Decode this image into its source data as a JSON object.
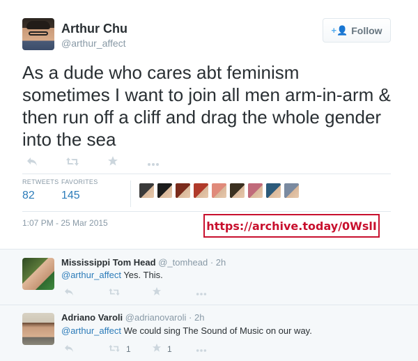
{
  "tweet": {
    "author_name": "Arthur Chu",
    "author_handle": "@arthur_affect",
    "follow_label": "Follow",
    "text": "As a dude who cares abt feminism sometimes I want to join all men arm-in-arm & then run off a cliff and drag the whole gender into the sea",
    "retweets_label": "RETWEETS",
    "retweets_count": "82",
    "favorites_label": "FAVORITES",
    "favorites_count": "145",
    "timestamp": "1:07 PM - 25 Mar 2015"
  },
  "annotation": {
    "archive_link": "https://archive.today/0WslI",
    "color": "#c8102e"
  },
  "icons": {
    "reply": "reply-icon",
    "retweet": "retweet-icon",
    "favorite": "star-icon",
    "more": "more-icon",
    "follow": "person-plus-icon"
  },
  "favoriter_colors": [
    "#3a3a3a",
    "#1c1c1c",
    "#7a2b1c",
    "#b03a2a",
    "#e08a7a",
    "#3b3020",
    "#c06a7a",
    "#2c5a7a",
    "#7a8aa0",
    "#a07a5a"
  ],
  "replies": [
    {
      "name": "Mississippi Tom Head",
      "handle": "@_tomhead",
      "time": "· 2h",
      "mention": "@arthur_affect",
      "text": " Yes. This.",
      "retweet_count": "",
      "favorite_count": ""
    },
    {
      "name": "Adriano Varoli",
      "handle": "@adrianovaroli",
      "time": "· 2h",
      "mention": "@arthur_affect",
      "text": " We could sing The Sound of Music on our way.",
      "retweet_count": "1",
      "favorite_count": "1"
    }
  ]
}
